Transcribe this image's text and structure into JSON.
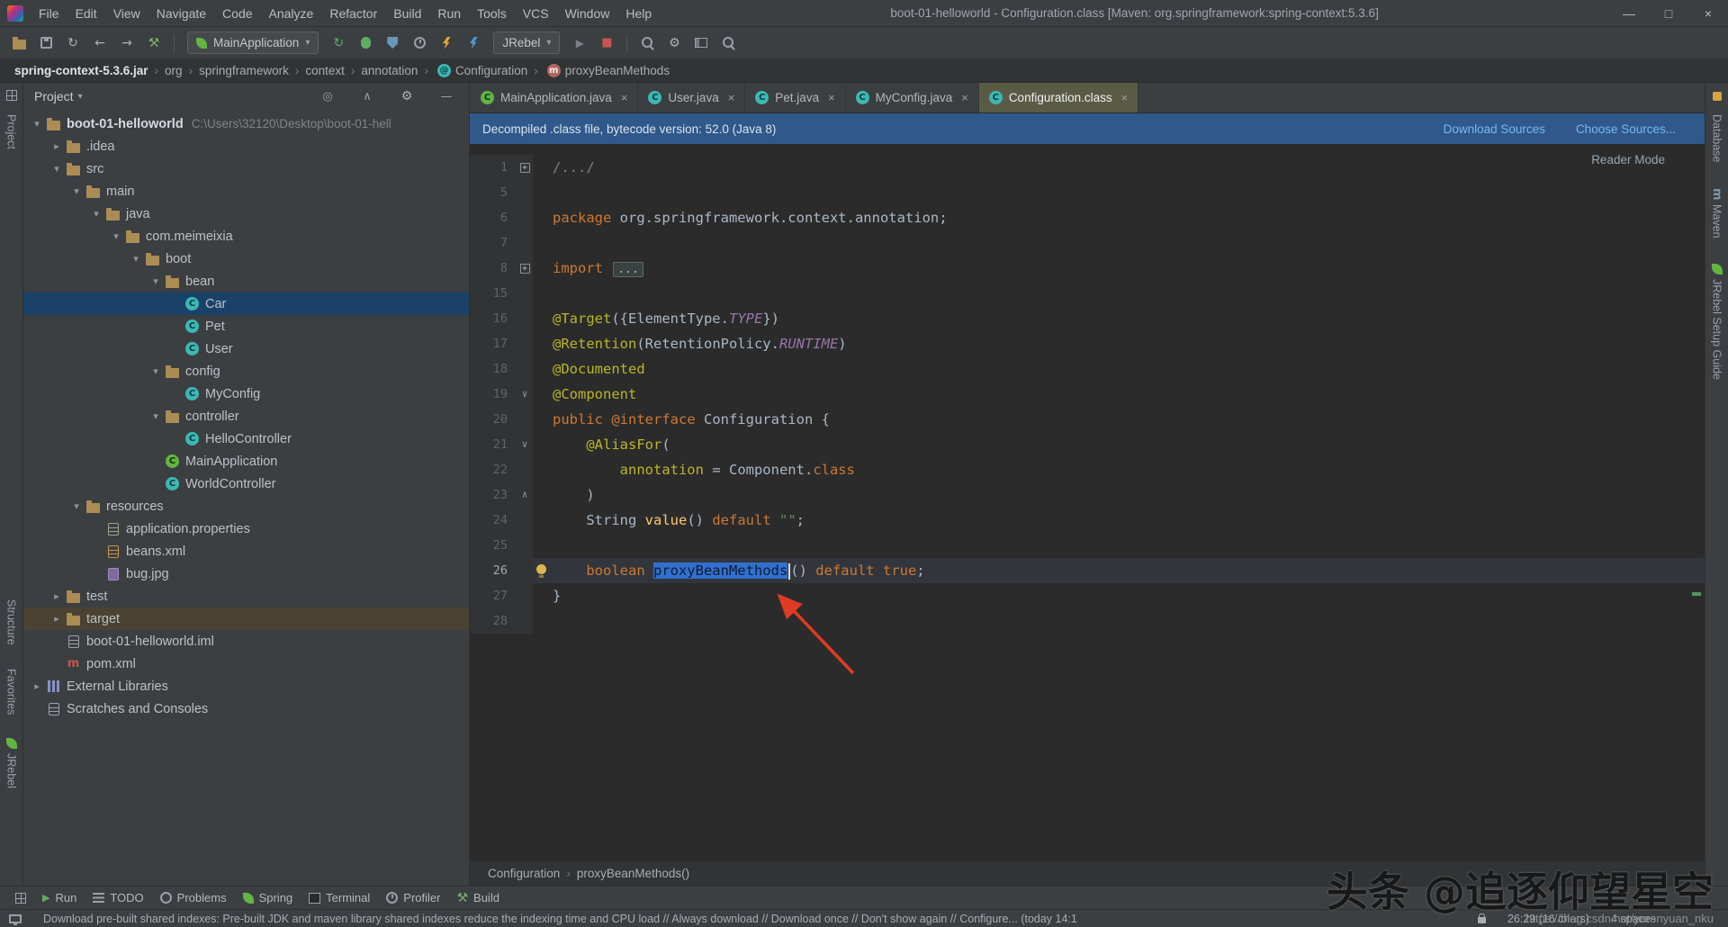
{
  "colors": {
    "selection_blue": "#3170cf",
    "banner_blue": "#30588a",
    "tree_selection_blue": "#1a4269",
    "excluded_brown": "#4a4233",
    "arrow_red": "#e03b24"
  },
  "titlebar": {
    "menus": [
      "File",
      "Edit",
      "View",
      "Navigate",
      "Code",
      "Analyze",
      "Refactor",
      "Build",
      "Run",
      "Tools",
      "VCS",
      "Window",
      "Help"
    ],
    "title": "boot-01-helloworld - Configuration.class [Maven: org.springframework:spring-context:5.3.6]",
    "window_controls": [
      {
        "name": "minimize-button",
        "glyph": "—"
      },
      {
        "name": "maximize-button",
        "glyph": "□"
      },
      {
        "name": "close-button",
        "glyph": "×"
      }
    ]
  },
  "toolbar": {
    "left_icons": [
      "open-project-icon",
      "save-all-icon",
      "sync-icon",
      "back-icon",
      "forward-icon",
      "build-icon"
    ],
    "run_config_label": "MainApplication",
    "run_icons": [
      "rerun-icon",
      "debug-icon",
      "coverage-icon",
      "profiler-icon",
      "jrebel-run-icon",
      "jrebel-debug-icon"
    ],
    "jrebel_label": "JRebel",
    "post_icons": [
      "run-muted-icon",
      "stop-icon"
    ],
    "right_icons": [
      "find-icon",
      "wrench-icon",
      "layout-icon",
      "search-icon"
    ]
  },
  "breadcrumb_bar": {
    "items": [
      {
        "label": "spring-context-5.3.6.jar",
        "bold": true
      },
      {
        "label": "org"
      },
      {
        "label": "springframework"
      },
      {
        "label": "context"
      },
      {
        "label": "annotation"
      },
      {
        "label": "Configuration",
        "icon": "annotation-icon"
      },
      {
        "label": "proxyBeanMethods",
        "icon": "method-icon"
      }
    ]
  },
  "stripes": {
    "left": [
      {
        "label": "Project",
        "icon": "project-tool-icon"
      },
      {
        "label": "Structure",
        "icon": "structure-icon"
      },
      {
        "label": "Favorites",
        "icon": "favorites-icon"
      },
      {
        "label": "JRebel",
        "icon": "jrebel-icon"
      }
    ],
    "right": [
      {
        "label": "Database",
        "icon": "db-icon"
      },
      {
        "label": "Maven",
        "icon": "maven-tab-icon"
      },
      {
        "label": "JRebel Setup Guide",
        "icon": "jrebel-icon"
      }
    ]
  },
  "project": {
    "header": "Project",
    "actions": [
      "locate-icon",
      "collapse-icon",
      "settings-icon",
      "hide-icon"
    ],
    "tree": [
      {
        "label": "boot-01-helloworld",
        "hint": "C:\\Users\\32120\\Desktop\\boot-01-hell",
        "level": 0,
        "icon": "project-icon",
        "chevron": "down",
        "bold": true
      },
      {
        "label": ".idea",
        "level": 1,
        "icon": "folder-icon",
        "chevron": "right"
      },
      {
        "label": "src",
        "level": 1,
        "icon": "folder-icon",
        "chevron": "down"
      },
      {
        "label": "main",
        "level": 2,
        "icon": "folder-icon",
        "chevron": "down"
      },
      {
        "label": "java",
        "level": 3,
        "icon": "folder-icon",
        "chevron": "down"
      },
      {
        "label": "com.meimeixia",
        "level": 4,
        "icon": "package-icon",
        "chevron": "down"
      },
      {
        "label": "boot",
        "level": 5,
        "icon": "package-icon",
        "chevron": "down"
      },
      {
        "label": "bean",
        "level": 6,
        "icon": "package-icon",
        "chevron": "down"
      },
      {
        "label": "Car",
        "level": 7,
        "icon": "class-icon",
        "selected": true
      },
      {
        "label": "Pet",
        "level": 7,
        "icon": "class-icon"
      },
      {
        "label": "User",
        "level": 7,
        "icon": "class-icon"
      },
      {
        "label": "config",
        "level": 6,
        "icon": "package-icon",
        "chevron": "down"
      },
      {
        "label": "MyConfig",
        "level": 7,
        "icon": "class-icon"
      },
      {
        "label": "controller",
        "level": 6,
        "icon": "package-icon",
        "chevron": "down"
      },
      {
        "label": "HelloController",
        "level": 7,
        "icon": "class-icon"
      },
      {
        "label": "MainApplication",
        "level": 6,
        "icon": "main-class-icon"
      },
      {
        "label": "WorldController",
        "level": 6,
        "icon": "class-icon"
      },
      {
        "label": "resources",
        "level": 2,
        "icon": "folder-icon",
        "chevron": "down"
      },
      {
        "label": "application.properties",
        "level": 3,
        "icon": "properties-icon"
      },
      {
        "label": "beans.xml",
        "level": 3,
        "icon": "xml-icon"
      },
      {
        "label": "bug.jpg",
        "level": 3,
        "icon": "image-icon"
      },
      {
        "label": "test",
        "level": 1,
        "icon": "folder-icon",
        "chevron": "right"
      },
      {
        "label": "target",
        "level": 1,
        "icon": "folder-icon",
        "chevron": "right",
        "excluded": true
      },
      {
        "label": "boot-01-helloworld.iml",
        "level": 1,
        "icon": "iml-icon"
      },
      {
        "label": "pom.xml",
        "level": 1,
        "icon": "maven-icon"
      },
      {
        "label": "External Libraries",
        "level": 0,
        "icon": "libraries-icon",
        "chevron": "right"
      },
      {
        "label": "Scratches and Consoles",
        "level": 0,
        "icon": "scratches-icon"
      }
    ]
  },
  "editor": {
    "tabs": [
      {
        "label": "MainApplication.java",
        "icon": "main-class-icon"
      },
      {
        "label": "User.java",
        "icon": "class-icon"
      },
      {
        "label": "Pet.java",
        "icon": "class-icon"
      },
      {
        "label": "MyConfig.java",
        "icon": "class-icon"
      },
      {
        "label": "Configuration.class",
        "icon": "class-icon",
        "active": true
      }
    ],
    "notification": {
      "text": "Decompiled .class file, bytecode version: 52.0 (Java 8)",
      "actions": [
        "Download Sources",
        "Choose Sources..."
      ]
    },
    "reader_mode": "Reader Mode",
    "code": {
      "lines": [
        {
          "n": "1",
          "f": "p",
          "t": [
            [
              "/.../",
              "cm"
            ]
          ]
        },
        {
          "n": "5",
          "t": []
        },
        {
          "n": "6",
          "t": [
            [
              "package ",
              "kw"
            ],
            [
              "org.springframework.context.annotation;",
              "pl"
            ]
          ]
        },
        {
          "n": "7",
          "t": []
        },
        {
          "n": "8",
          "f": "p",
          "t": [
            [
              "import ",
              "kw"
            ],
            [
              "...",
              "fold"
            ]
          ]
        },
        {
          "n": "15",
          "t": []
        },
        {
          "n": "16",
          "t": [
            [
              "@Target",
              "an"
            ],
            [
              "({ElementType.",
              "pl"
            ],
            [
              "TYPE",
              "cn"
            ],
            [
              "})",
              "pl"
            ]
          ]
        },
        {
          "n": "17",
          "t": [
            [
              "@Retention",
              "an"
            ],
            [
              "(RetentionPolicy.",
              "pl"
            ],
            [
              "RUNTIME",
              "cn"
            ],
            [
              ")",
              "pl"
            ]
          ]
        },
        {
          "n": "18",
          "t": [
            [
              "@Documented",
              "an"
            ]
          ]
        },
        {
          "n": "19",
          "f": "d",
          "t": [
            [
              "@Component",
              "an"
            ]
          ]
        },
        {
          "n": "20",
          "t": [
            [
              "public ",
              "kw"
            ],
            [
              "@interface ",
              "kw"
            ],
            [
              "Configuration {",
              "pl"
            ]
          ]
        },
        {
          "n": "21",
          "f": "d",
          "t": [
            [
              "    ",
              "pl"
            ],
            [
              "@AliasFor",
              "an"
            ],
            [
              "(",
              "pl"
            ]
          ]
        },
        {
          "n": "22",
          "t": [
            [
              "        annotation",
              "an"
            ],
            [
              " = ",
              "pl"
            ],
            [
              "Component.",
              "pl"
            ],
            [
              "class",
              "kw"
            ]
          ]
        },
        {
          "n": "23",
          "f": "u",
          "t": [
            [
              "    )",
              "pl"
            ]
          ]
        },
        {
          "n": "24",
          "t": [
            [
              "    String ",
              "pl"
            ],
            [
              "value",
              "mt"
            ],
            [
              "() ",
              "pl"
            ],
            [
              "default ",
              "kw"
            ],
            [
              "\"\"",
              "st"
            ],
            [
              ";",
              "pl"
            ]
          ]
        },
        {
          "n": "25",
          "t": []
        },
        {
          "n": "26",
          "cur": true,
          "bulb": true,
          "t": [
            [
              "    ",
              "pl"
            ],
            [
              "boolean ",
              "kw"
            ],
            [
              "proxyBeanMethods",
              "sel"
            ],
            [
              "",
              "caret"
            ],
            [
              "() ",
              "pl"
            ],
            [
              "default ",
              "kw"
            ],
            [
              "true",
              "kw"
            ],
            [
              ";",
              "pl"
            ]
          ]
        },
        {
          "n": "27",
          "t": [
            [
              "}",
              "pl"
            ]
          ]
        },
        {
          "n": "28",
          "t": []
        }
      ]
    },
    "breadcrumb": [
      "Configuration",
      "proxyBeanMethods()"
    ]
  },
  "bottom_bar": {
    "items": [
      {
        "label": "Run",
        "icon": "run-icon"
      },
      {
        "label": "TODO",
        "icon": "todo-icon"
      },
      {
        "label": "Problems",
        "icon": "problems-icon"
      },
      {
        "label": "Spring",
        "icon": "spring-leaf-icon"
      },
      {
        "label": "Terminal",
        "icon": "terminal-icon"
      },
      {
        "label": "Profiler",
        "icon": "profiler-icon"
      },
      {
        "label": "Build",
        "icon": "build-icon"
      }
    ]
  },
  "status_bar": {
    "message": "Download pre-built shared indexes: Pre-built JDK and maven library shared indexes reduce the indexing time and CPU load // Always download // Download once // Don't show again // Configure... (today 14:1",
    "caret_position": "26:29 (16 chars)",
    "indent": "4 spaces"
  },
  "watermark": {
    "big": "头条 @追逐仰望星空",
    "url": "https://blog.csdn.net/yerenyuan_nku"
  }
}
